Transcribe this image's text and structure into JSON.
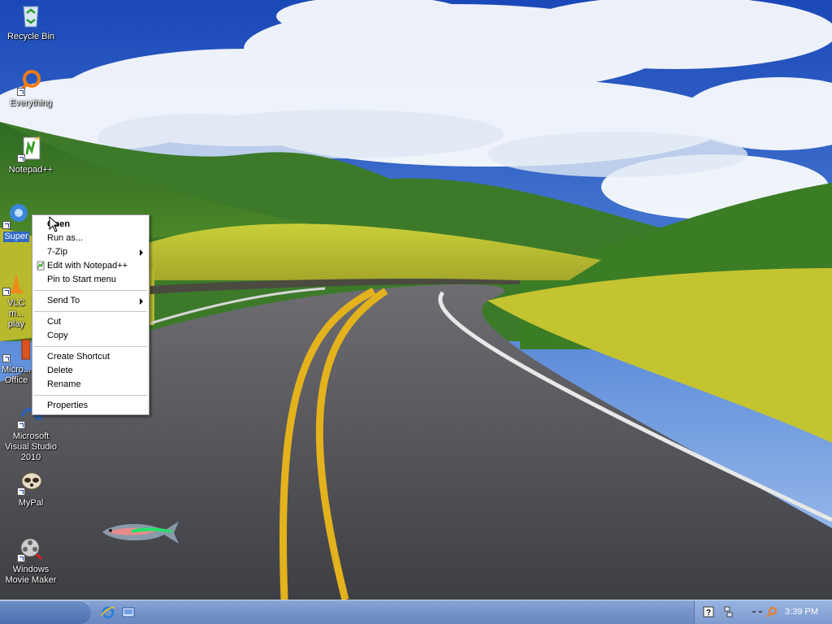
{
  "desktop": {
    "icons": [
      {
        "label": "Recycle Bin"
      },
      {
        "label": "Everything"
      },
      {
        "label": "Notepad++"
      },
      {
        "label": "Super"
      },
      {
        "label": "VLC m... play"
      },
      {
        "label": "Micro... Office"
      },
      {
        "label": "Microsoft Visual Studio 2010"
      },
      {
        "label": "MyPal"
      },
      {
        "label": "Windows Movie Maker"
      }
    ]
  },
  "context_menu": {
    "items": [
      {
        "label": "Open",
        "bold": true
      },
      {
        "label": "Run as..."
      },
      {
        "label": "7-Zip",
        "submenu": true
      },
      {
        "label": "Edit with Notepad++",
        "icon": "notepadpp-icon"
      },
      {
        "label": "Pin to Start menu"
      },
      {
        "label": "Send To",
        "submenu": true
      },
      {
        "label": "Cut"
      },
      {
        "label": "Copy"
      },
      {
        "label": "Create Shortcut"
      },
      {
        "label": "Delete"
      },
      {
        "label": "Rename"
      },
      {
        "label": "Properties"
      }
    ]
  },
  "taskbar": {
    "clock": "3:39 PM"
  },
  "colors": {
    "selection": "#316ac5",
    "taskbar": "#7896cb"
  }
}
